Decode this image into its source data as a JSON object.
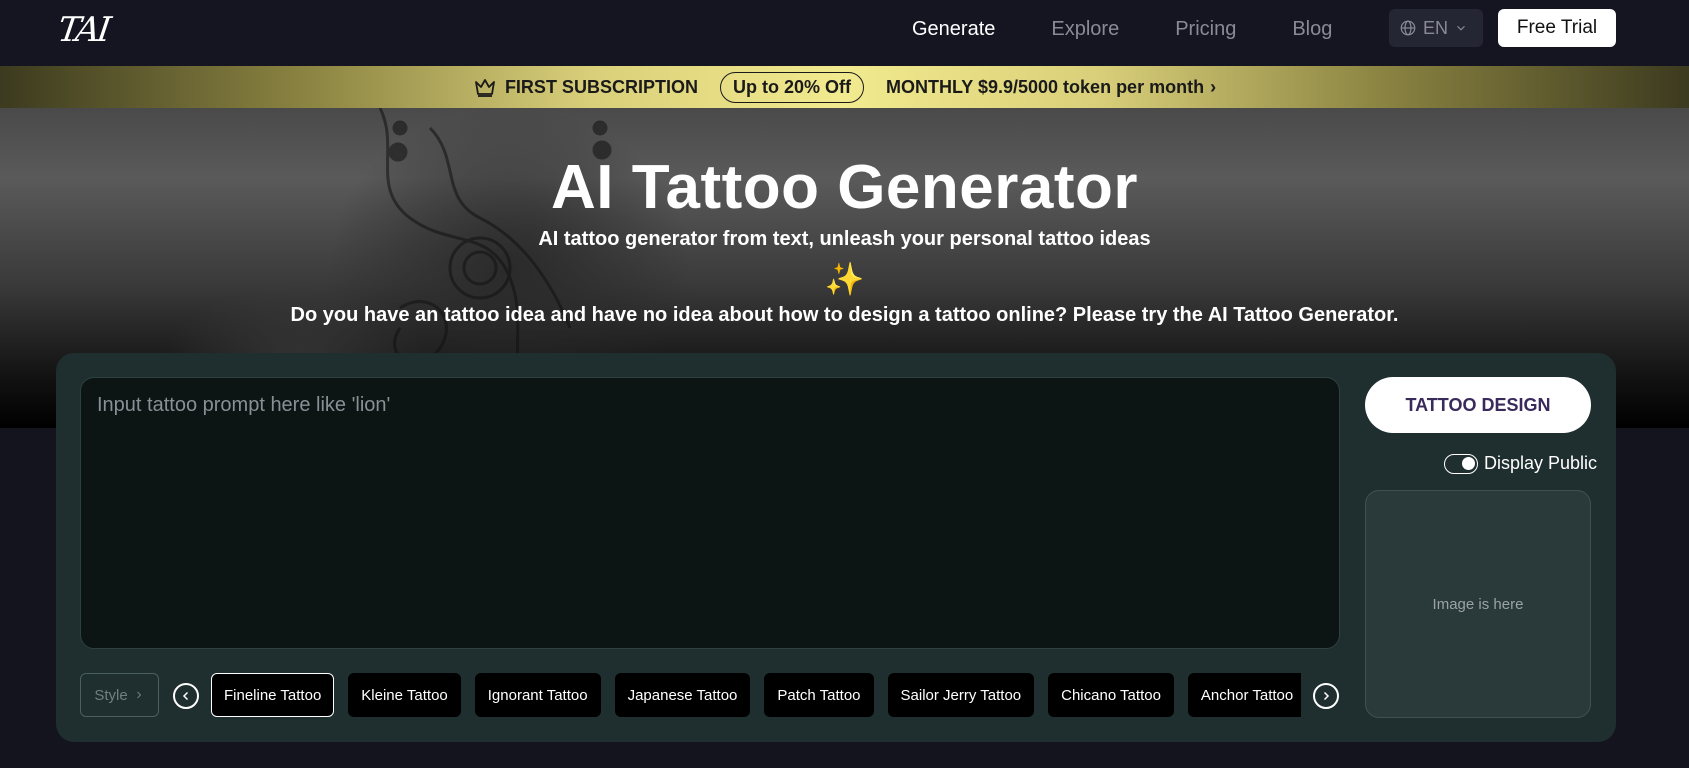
{
  "nav": {
    "logo": "TAI",
    "links": [
      {
        "label": "Generate",
        "active": true
      },
      {
        "label": "Explore",
        "active": false
      },
      {
        "label": "Pricing",
        "active": false
      },
      {
        "label": "Blog",
        "active": false
      }
    ],
    "language": "EN",
    "free_trial_label": "Free Trial"
  },
  "promo": {
    "icon": "crown-icon",
    "first_label": "FIRST SUBSCRIPTION",
    "discount_label": "Up to 20% Off",
    "offer_label": "MONTHLY $9.9/5000 token per month",
    "arrow": "›"
  },
  "hero": {
    "title": "AI Tattoo Generator",
    "subtitle": "AI tattoo generator from text, unleash your personal tattoo ideas",
    "sparkle": "✨",
    "description": "Do you have an tattoo idea and have no idea about how to design a tattoo online? Please try the AI Tattoo Generator."
  },
  "generator": {
    "prompt_placeholder": "Input tattoo prompt here like 'lion'",
    "prompt_value": "",
    "design_button_label": "TATTOO DESIGN",
    "display_public_label": "Display Public",
    "display_public_on": true,
    "image_placeholder": "Image is here",
    "style_label": "Style",
    "styles": [
      {
        "label": "Fineline Tattoo",
        "selected": true
      },
      {
        "label": "Kleine Tattoo",
        "selected": false
      },
      {
        "label": "Ignorant Tattoo",
        "selected": false
      },
      {
        "label": "Japanese Tattoo",
        "selected": false
      },
      {
        "label": "Patch Tattoo",
        "selected": false
      },
      {
        "label": "Sailor Jerry Tattoo",
        "selected": false
      },
      {
        "label": "Chicano Tattoo",
        "selected": false
      },
      {
        "label": "Anchor Tattoo",
        "selected": false
      }
    ]
  }
}
